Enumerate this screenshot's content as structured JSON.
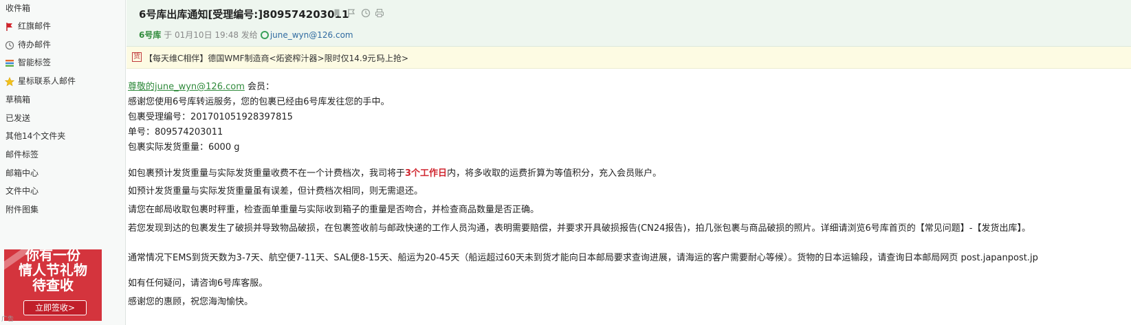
{
  "sidebar": {
    "items": [
      {
        "label": "收件箱",
        "icon": "none"
      },
      {
        "label": "红旗邮件",
        "icon": "red-flag-icon"
      },
      {
        "label": "待办邮件",
        "icon": "clock-icon"
      },
      {
        "label": "智能标签",
        "icon": "tag-lines-icon"
      },
      {
        "label": "星标联系人邮件",
        "icon": "star-icon"
      },
      {
        "label": "草稿箱",
        "icon": "none"
      },
      {
        "label": "已发送",
        "icon": "none"
      },
      {
        "label": "其他14个文件夹",
        "icon": "none"
      },
      {
        "label": "邮件标签",
        "icon": "none"
      },
      {
        "label": "邮箱中心",
        "icon": "none"
      },
      {
        "label": "文件中心",
        "icon": "none"
      },
      {
        "label": "附件图集",
        "icon": "none"
      }
    ],
    "ad": {
      "line1": "你有一份",
      "line2": "情人节礼物",
      "line3": "待查收",
      "button": "立即签收>",
      "tag": "广告"
    }
  },
  "header": {
    "subject": "6号库出库通知[受理编号:]809574203011",
    "sender": "6号库",
    "at": "于",
    "datetime": "01月10日 19:48",
    "sent_to": "发给",
    "recipient": "june_wyn@126.com"
  },
  "promo": {
    "icon_text": "货",
    "text": "【每天维C相伴】德国WMF制造商<炻瓷榨汁器>限时仅14.9元！",
    "link": "马上抢>"
  },
  "body": {
    "greeting_link": "尊敬的june_wyn@126.com",
    "greeting_suffix": " 会员：",
    "thanks": "感谢您使用6号库转运服务，您的包裹已经由6号库发往您的手中。",
    "tracking_id": "包裹受理编号：201701051928397815",
    "order_no": "单号：809574203011",
    "weight": "包裹实际发货重量：6000 g",
    "para1_a": "如包裹预计发货重量与实际发货重量收费不在一个计费档次，我司将于",
    "para1_highlight": "3个工作日",
    "para1_b": "内，将多收取的运费折算为等值积分，充入会员账户。",
    "para2": "如预计发货重量与实际发货重量虽有误差，但计费档次相同，则无需退还。",
    "para3": "请您在邮局收取包裹时秤重，检查面单重量与实际收到箱子的重量是否吻合，并检查商品数量是否正确。",
    "para4": "若您发现到达的包裹发生了破损并导致物品破损，在包裹签收前与邮政快递的工作人员沟通，表明需要赔偿，并要求开具破损报告(CN24报告)，拍几张包裹与商品破损的照片。详细请浏览6号库首页的【常见问题】-【发货出库】。",
    "para5": "通常情况下EMS到货天数为3-7天、航空便7-11天、SAL便8-15天、船运为20-45天（船运超过60天未到货才能向日本邮局要求查询进展，请海运的客户需要耐心等候）。货物的日本运输段，请查询日本邮局网页 post.japanpost.jp",
    "para6": "如有任何疑问，请咨询6号库客服。",
    "para7": "感谢您的惠顾，祝您海淘愉快。"
  },
  "colors": {
    "header_bg": "#eef6ef",
    "promo_bg": "#fdfbe3",
    "sender_green": "#2f8a3b",
    "highlight_red": "#d0262f"
  }
}
